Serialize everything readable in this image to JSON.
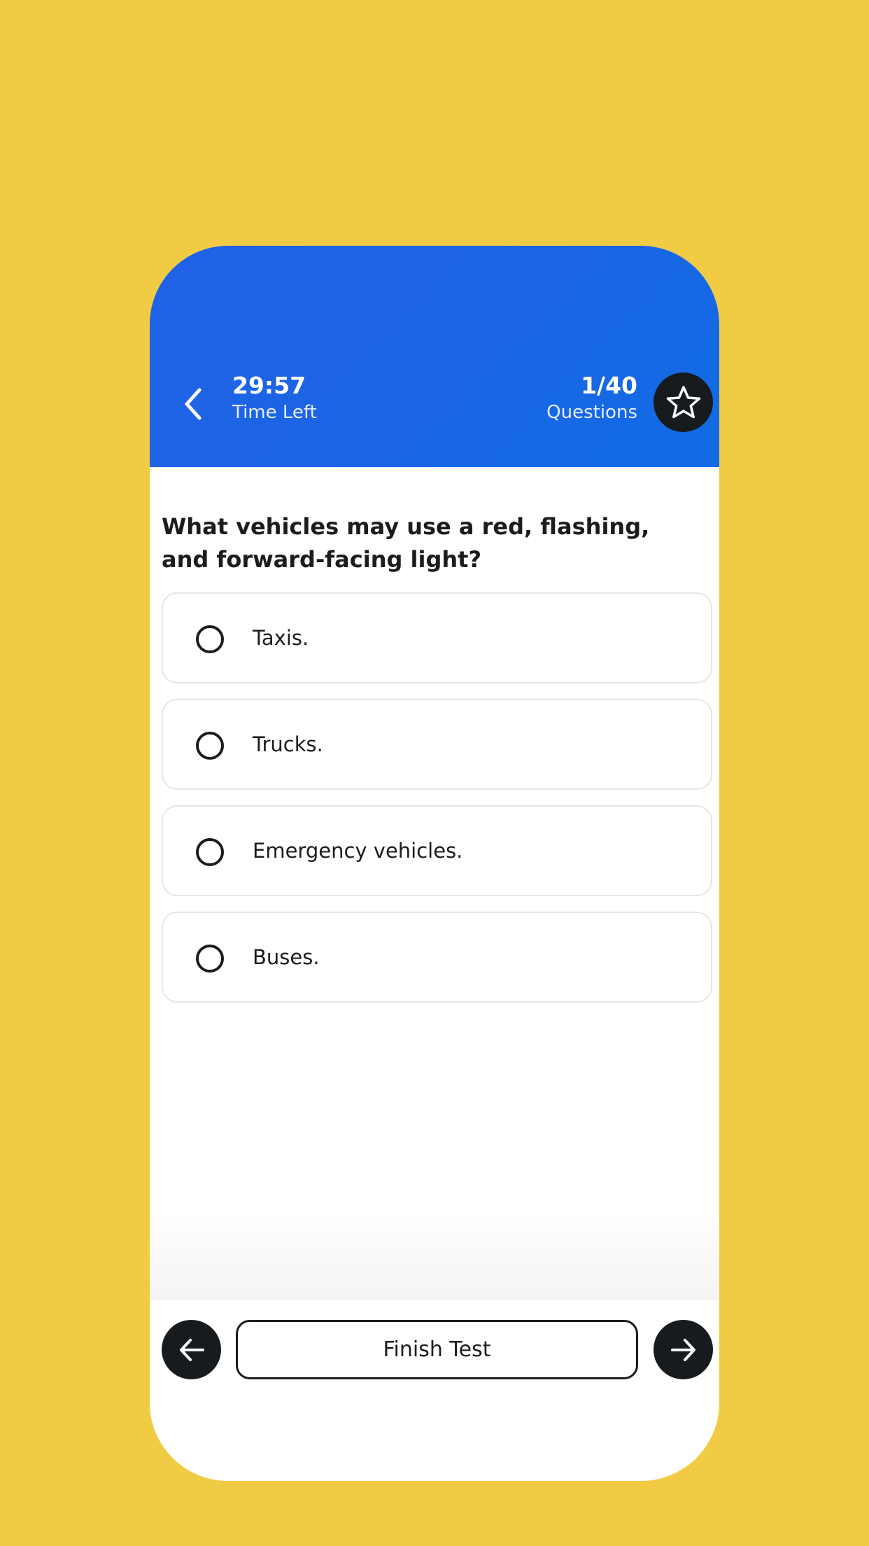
{
  "colors": {
    "background": "#f2cb45",
    "header": "#1b65e4",
    "dark_button": "#171b1d",
    "text": "#1a1c1e"
  },
  "header": {
    "back_icon": "chevron-left-icon",
    "timer_value": "29:57",
    "timer_label": "Time Left",
    "question_count": "1/40",
    "question_count_label": "Questions",
    "bookmark_icon": "star-outline-icon"
  },
  "question": {
    "text": "What vehicles may use a red, flashing, and forward-facing light?",
    "options": [
      {
        "label": "Taxis.",
        "selected": false
      },
      {
        "label": "Trucks.",
        "selected": false
      },
      {
        "label": "Emergency vehicles.",
        "selected": false
      },
      {
        "label": "Buses.",
        "selected": false
      }
    ]
  },
  "footer": {
    "prev_icon": "arrow-left-icon",
    "finish_label": "Finish Test",
    "next_icon": "arrow-right-icon"
  }
}
